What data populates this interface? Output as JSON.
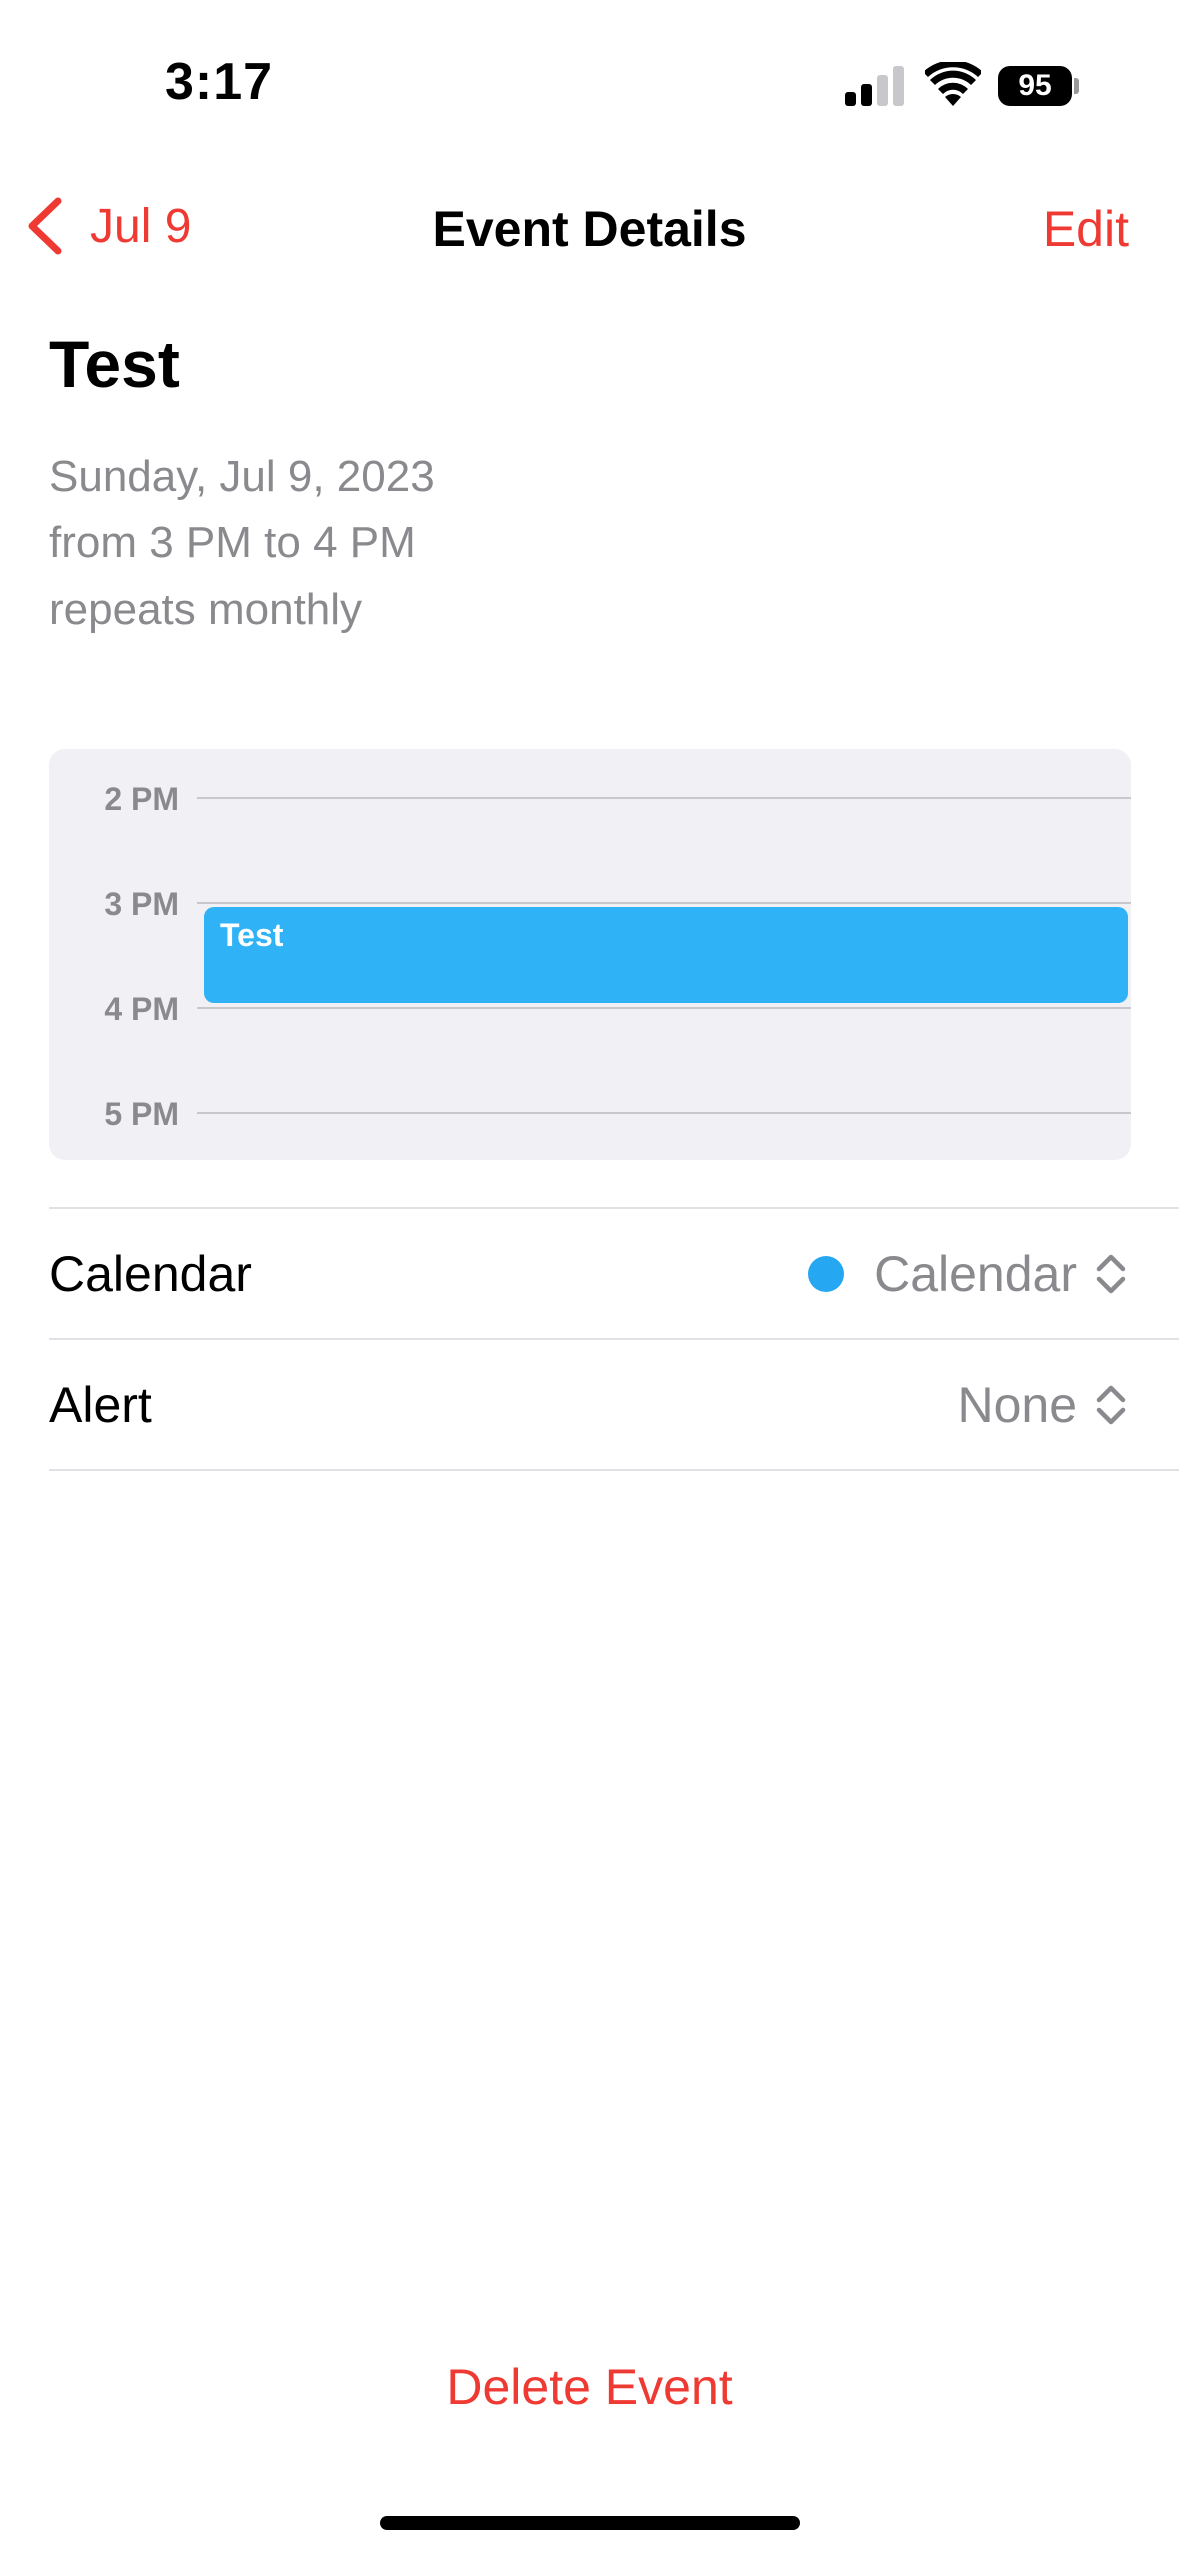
{
  "status_bar": {
    "time": "3:17",
    "battery": "95"
  },
  "nav": {
    "back_label": "Jul 9",
    "title": "Event Details",
    "edit_label": "Edit"
  },
  "event": {
    "title": "Test",
    "date": "Sunday, Jul 9, 2023",
    "time_range": "from 3 PM to 4 PM",
    "repeat": "repeats monthly"
  },
  "timeline": {
    "hours": [
      "2 PM",
      "3 PM",
      "4 PM",
      "5 PM"
    ],
    "event_label": "Test",
    "event_color": "#30b2f7"
  },
  "rows": {
    "calendar": {
      "label": "Calendar",
      "value": "Calendar",
      "dot_color": "#25a7f2"
    },
    "alert": {
      "label": "Alert",
      "value": "None"
    }
  },
  "actions": {
    "delete_label": "Delete Event"
  },
  "colors": {
    "accent": "#ef3a33",
    "secondary_text": "#8a8a8e"
  }
}
